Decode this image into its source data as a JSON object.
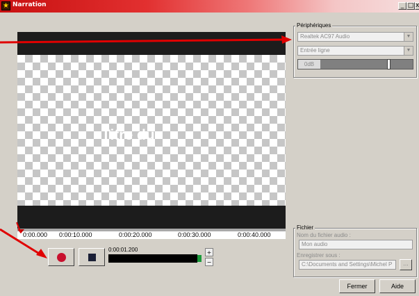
{
  "window": {
    "title": "Narration"
  },
  "preview": {
    "title_text": "Titre du"
  },
  "timeline": {
    "ticks": [
      "0:00.000",
      "0:00:10.000",
      "0:00:20.000",
      "0:00:30.000",
      "0:00:40.000"
    ]
  },
  "recording": {
    "time": "0:00:01.200"
  },
  "devices": {
    "group_label": "Périphériques",
    "device": "Realtek AC97 Audio",
    "input": "Entrée ligne",
    "level_label": "0dB"
  },
  "file": {
    "group_label": "Fichier",
    "name_label": "Nom du fichier audio :",
    "name_value": "Mon audio",
    "save_label": "Enregistrer sous :",
    "save_path": "C:\\Documents and Settings\\Michel P",
    "browse_label": "..."
  },
  "buttons": {
    "close": "Fermer",
    "help": "Aide"
  },
  "colors": {
    "titlebar": "#c81010",
    "record": "#c8102e",
    "arrow": "#e00000"
  },
  "icons": [
    "record-icon",
    "stop-icon",
    "zoom-in-icon",
    "zoom-out-icon",
    "minimize-icon",
    "maximize-icon",
    "close-icon"
  ]
}
